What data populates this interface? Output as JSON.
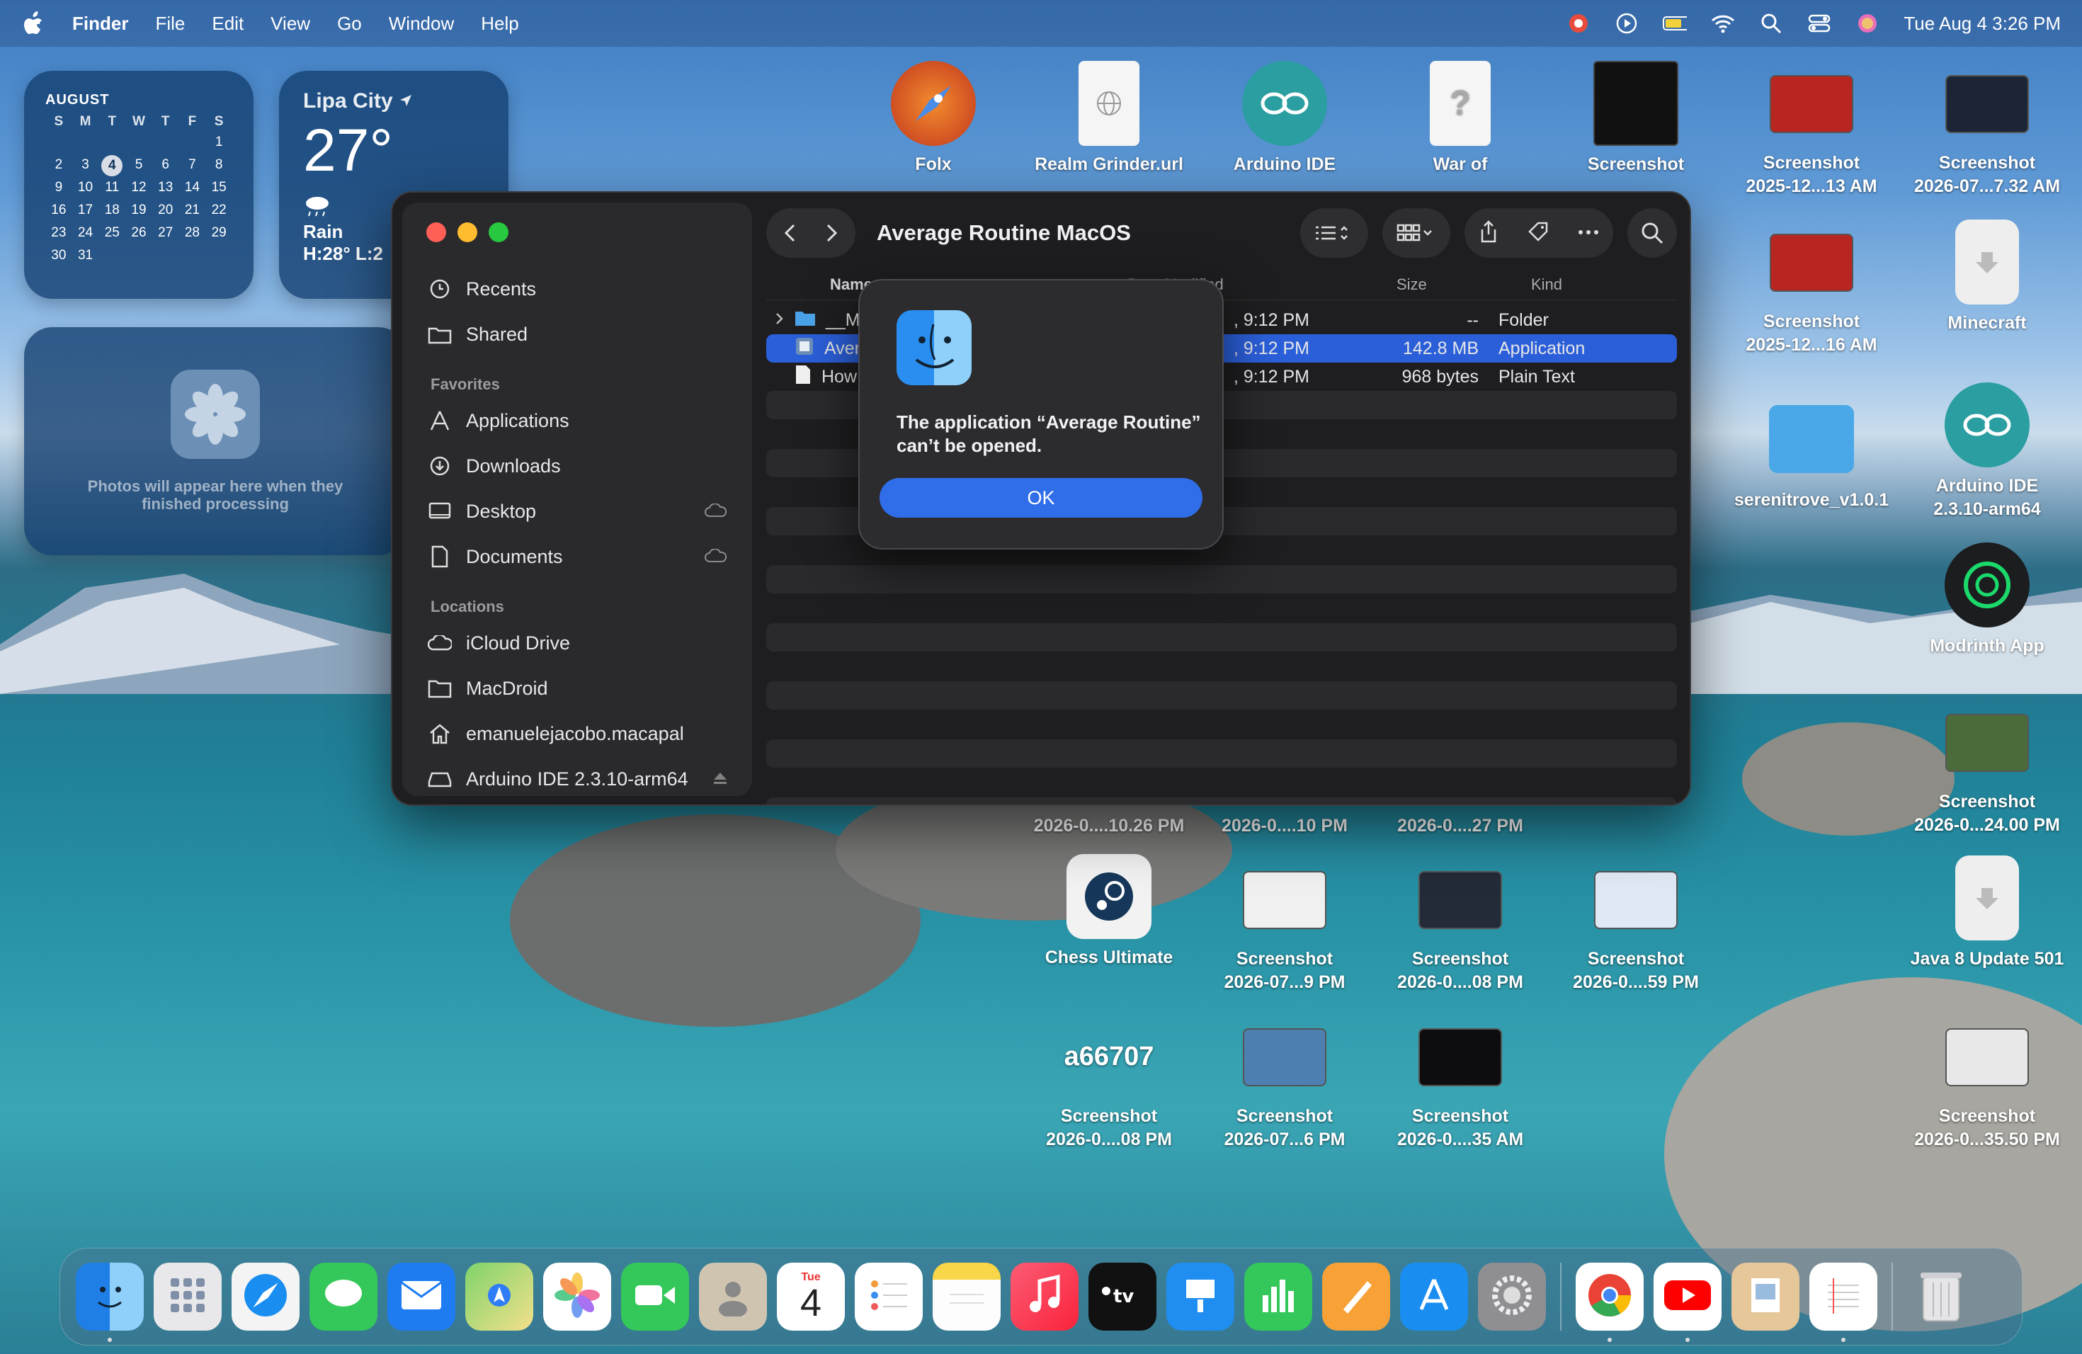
{
  "menubar": {
    "app_name": "Finder",
    "menus": [
      "File",
      "Edit",
      "View",
      "Go",
      "Window",
      "Help"
    ],
    "datetime": "Tue Aug 4  3:26 PM"
  },
  "calendar_widget": {
    "month": "AUGUST",
    "dow": [
      "S",
      "M",
      "T",
      "W",
      "T",
      "F",
      "S"
    ],
    "days": [
      "",
      "",
      "",
      "",
      "",
      "",
      "1",
      "2",
      "3",
      "4",
      "5",
      "6",
      "7",
      "8",
      "9",
      "10",
      "11",
      "12",
      "13",
      "14",
      "15",
      "16",
      "17",
      "18",
      "19",
      "20",
      "21",
      "22",
      "23",
      "24",
      "25",
      "26",
      "27",
      "28",
      "29",
      "30",
      "31"
    ],
    "today": "4"
  },
  "weather_widget": {
    "city": "Lipa City",
    "temp": "27°",
    "condition": "Rain",
    "high_low": "H:28° L:2"
  },
  "photos_widget": {
    "text": "Photos will appear here when they finished processing"
  },
  "desktop": {
    "icons": [
      {
        "label": "Folx",
        "sub": ""
      },
      {
        "label": "Realm Grinder.url",
        "sub": ""
      },
      {
        "label": "Arduino IDE",
        "sub": ""
      },
      {
        "label": "War of",
        "sub": ""
      },
      {
        "label": "Screenshot",
        "sub": ""
      },
      {
        "label": "Screenshot",
        "sub": "2025-12...13 AM"
      },
      {
        "label": "Screenshot",
        "sub": "2026-07...7.32 AM"
      },
      {
        "label": "Screenshot",
        "sub": "2025-12...16 AM"
      },
      {
        "label": "Minecraft",
        "sub": ""
      },
      {
        "label": "serenitrove_v1.0.1",
        "sub": ""
      },
      {
        "label": "Arduino IDE",
        "sub": "2.3.10-arm64"
      },
      {
        "label": "Modrinth App",
        "sub": ""
      },
      {
        "label": "Screenshot",
        "sub": "2026-0...24.00 PM"
      },
      {
        "label": "Java 8 Update 501",
        "sub": ""
      },
      {
        "label": "Screenshot",
        "sub": "2026-0...35.50 PM"
      },
      {
        "label": "2026-0....10.26 PM",
        "sub": ""
      },
      {
        "label": "2026-0....10 PM",
        "sub": ""
      },
      {
        "label": "2026-0....27 PM",
        "sub": ""
      },
      {
        "label": "Chess Ultimate",
        "sub": ""
      },
      {
        "label": "Screenshot",
        "sub": "2026-07...9 PM"
      },
      {
        "label": "Screenshot",
        "sub": "2026-0....08 PM"
      },
      {
        "label": "Screenshot",
        "sub": "2026-0....59 PM"
      },
      {
        "label": "Screenshot",
        "sub": "2026-0....08 PM"
      },
      {
        "label": "Screenshot",
        "sub": "2026-07...6 PM"
      },
      {
        "label": "Screenshot",
        "sub": "2026-0....35 AM"
      },
      {
        "label": "PM",
        "sub": ""
      }
    ],
    "thumb_text": "a66707"
  },
  "finder": {
    "title": "Average Routine MacOS",
    "sidebar": {
      "items_top": [
        "Recents",
        "Shared"
      ],
      "favorites_header": "Favorites",
      "favorites": [
        "Applications",
        "Downloads",
        "Desktop",
        "Documents"
      ],
      "locations_header": "Locations",
      "locations": [
        "iCloud Drive",
        "MacDroid",
        "emanuelejacobo.macapal",
        "Arduino IDE 2.3.10-arm64"
      ]
    },
    "columns": {
      "name": "Name",
      "date": "Date Modified",
      "size": "Size",
      "kind": "Kind"
    },
    "files": [
      {
        "name": "__M",
        "date": ", 9:12 PM",
        "size": "--",
        "kind": "Folder"
      },
      {
        "name": "Aver",
        "date": ", 9:12 PM",
        "size": "142.8 MB",
        "kind": "Application"
      },
      {
        "name": "How",
        "date": ", 9:12 PM",
        "size": "968 bytes",
        "kind": "Plain Text"
      }
    ]
  },
  "alert": {
    "message": "The application “Average Routine” can’t be opened.",
    "ok_label": "OK"
  },
  "dock": {
    "calendar_day": "4",
    "calendar_month": "Tue",
    "apps": [
      "Finder",
      "Launchpad",
      "Safari",
      "Messages",
      "Mail",
      "Maps",
      "Photos",
      "FaceTime",
      "Contacts",
      "Calendar",
      "Reminders",
      "Notes",
      "Music",
      "TV",
      "Keynote",
      "Numbers",
      "Pages",
      "App Store",
      "System Settings",
      "Chrome",
      "YouTube",
      "Preview",
      "TextEdit",
      "Trash"
    ]
  },
  "colors": {
    "accent": "#2f6ee8",
    "selection": "#2b5fd9",
    "window_bg": "#1e1e20"
  }
}
